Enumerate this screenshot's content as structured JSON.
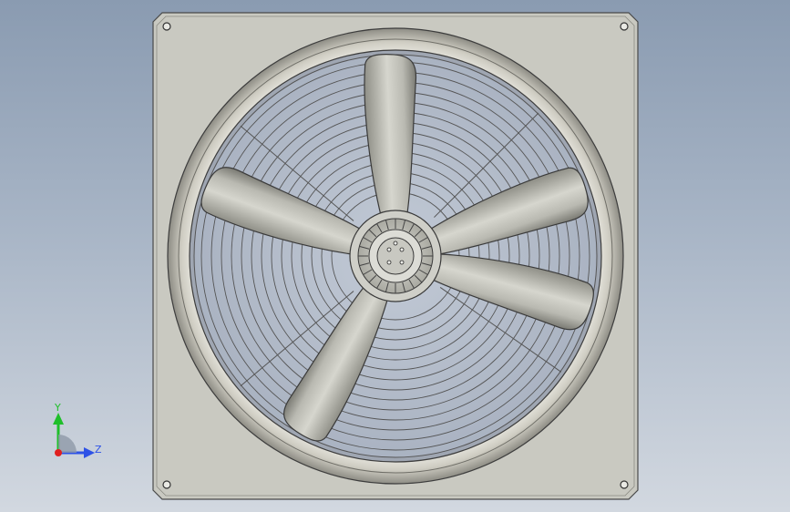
{
  "viewport": {
    "model": "axial-fan-assembly",
    "view": "front",
    "blade_count": 5,
    "colors": {
      "background_top": "#8a9bb1",
      "background_bottom": "#d2d8e0",
      "panel": "#c9c9c1",
      "shroud": "#d4d2c8",
      "guard_wire": "#555555",
      "blade": "#c4c4bb",
      "hub": "#d6d6cf"
    }
  },
  "triad": {
    "y_label": "Y",
    "z_label": "Z",
    "colors": {
      "x": "#e02020",
      "y": "#1fbf2a",
      "z": "#2e52e6"
    }
  }
}
